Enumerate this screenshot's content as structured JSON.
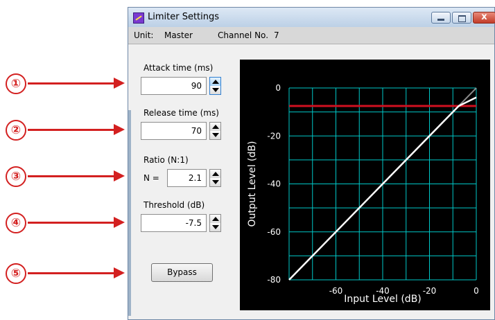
{
  "callouts": [
    "①",
    "②",
    "③",
    "④",
    "⑤"
  ],
  "window": {
    "title": "Limiter Settings",
    "close_glyph": "x"
  },
  "info": {
    "unit_label": "Unit:",
    "unit_value": "Master",
    "channel_label": "Channel No.",
    "channel_value": "7"
  },
  "fields": {
    "attack": {
      "label": "Attack time (ms)",
      "value": "90"
    },
    "release": {
      "label": "Release time (ms)",
      "value": "70"
    },
    "ratio": {
      "label": "Ratio (N:1)",
      "prefix": "N =",
      "value": "2.1"
    },
    "threshold": {
      "label": "Threshold (dB)",
      "value": "-7.5"
    }
  },
  "bypass_label": "Bypass",
  "colors": {
    "grid": "#00c8c8",
    "threshold": "#d01020",
    "curve": "#ffffff",
    "callout": "#d32020"
  },
  "chart_data": {
    "type": "line",
    "xlabel": "Input Level (dB)",
    "ylabel": "Output Level (dB)",
    "xlim": [
      -80,
      0
    ],
    "ylim": [
      -80,
      0
    ],
    "x_ticks": [
      "-60",
      "-40",
      "-20",
      "0"
    ],
    "y_ticks": [
      "0",
      "-20",
      "-40",
      "-60",
      "-80"
    ],
    "x_tick_values": [
      -60,
      -40,
      -20,
      0
    ],
    "y_tick_values": [
      0,
      -20,
      -40,
      -60,
      -80
    ],
    "grid": true,
    "grid_step": 10,
    "threshold_db": -7.5,
    "ratio": 2.1,
    "series": [
      {
        "x": [
          -80,
          -7.5,
          0
        ],
        "y": [
          -80,
          -7.5,
          -3.93
        ]
      }
    ]
  }
}
